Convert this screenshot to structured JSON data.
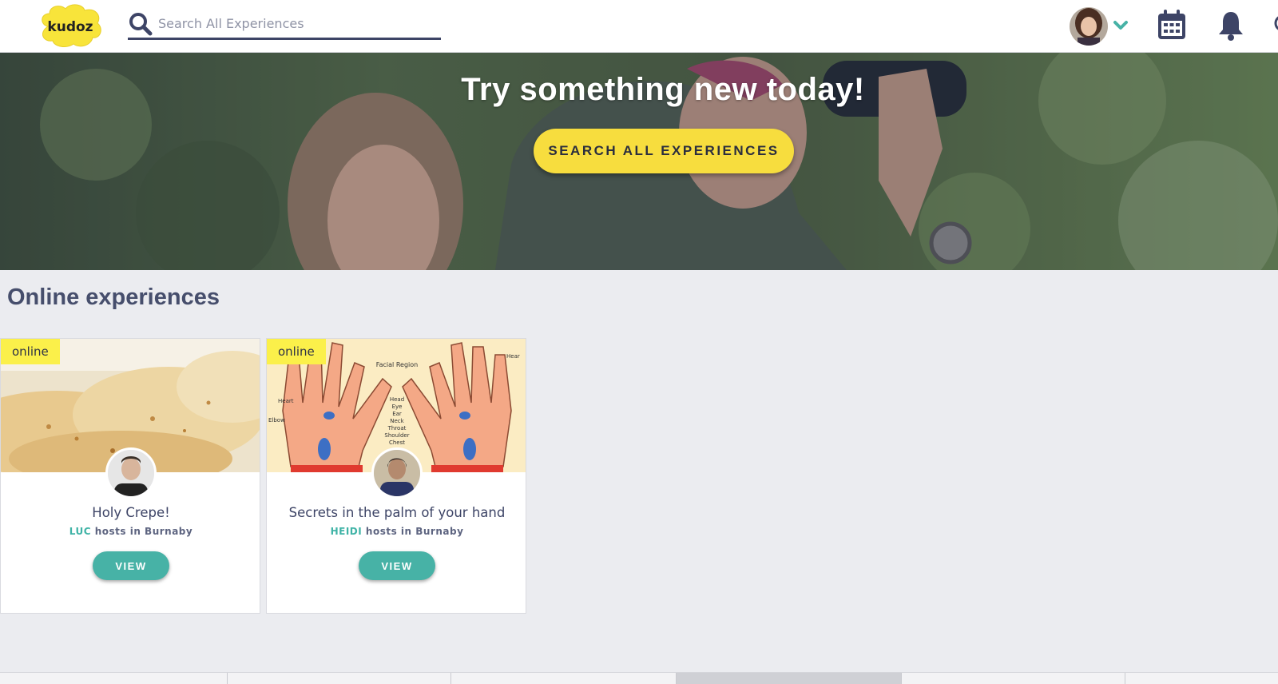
{
  "brand": {
    "logo_text": "kudoz",
    "logo_color": "#f8e43a"
  },
  "search": {
    "placeholder": "Search All Experiences",
    "icon": "search-icon"
  },
  "header_icons": [
    "avatar",
    "chevron-down-icon",
    "calendar-icon",
    "bell-icon",
    "chat-icon"
  ],
  "hero": {
    "title": "Try something new today!",
    "button_label": "SEARCH ALL EXPERIENCES"
  },
  "section": {
    "title": "Online experiences"
  },
  "cards": [
    {
      "badge": "online",
      "title": "Holy Crepe!",
      "host": "LUC",
      "host_suffix": "hosts in Burnaby",
      "button": "VIEW"
    },
    {
      "badge": "online",
      "title": "Secrets in the palm of your hand",
      "host": "HEIDI",
      "host_suffix": "hosts in Burnaby",
      "button": "VIEW"
    }
  ],
  "colors": {
    "accent": "#47b2a6",
    "cta": "#f7dd3e",
    "badge": "#fbf04a",
    "text": "#3d4466"
  }
}
